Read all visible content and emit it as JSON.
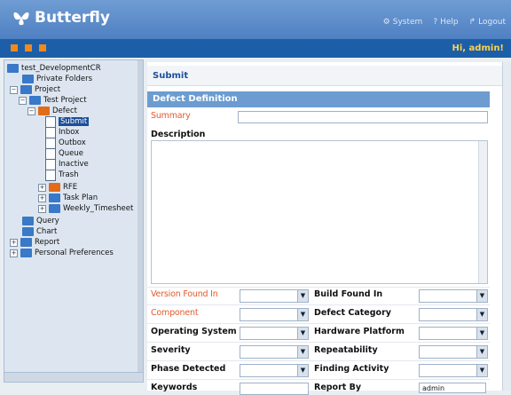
{
  "header": {
    "app_name": "Butterfly",
    "nav": {
      "system": "System",
      "help": "Help",
      "logout": "Logout"
    },
    "greeting": "Hi, admin!"
  },
  "tree": {
    "root": "test_DevelopmentCR",
    "private_folders": "Private Folders",
    "project": "Project",
    "test_project": "Test Project",
    "defect": "Defect",
    "submit": "Submit",
    "inbox": "Inbox",
    "outbox": "Outbox",
    "queue": "Queue",
    "inactive": "Inactive",
    "trash": "Trash",
    "rfe": "RFE",
    "task_plan": "Task Plan",
    "weekly_timesheet": "Weekly_Timesheet",
    "query": "Query",
    "chart": "Chart",
    "report": "Report",
    "personal_preferences": "Personal Preferences"
  },
  "form": {
    "breadcrumb": "Submit",
    "section_title": "Defect Definition",
    "summary_label": "Summary",
    "description_label": "Description",
    "version_found_in": "Version Found In",
    "build_found_in": "Build Found In",
    "component": "Component",
    "defect_category": "Defect Category",
    "operating_system": "Operating System",
    "hardware_platform": "Hardware Platform",
    "severity": "Severity",
    "repeatability": "Repeatability",
    "phase_detected": "Phase Detected",
    "finding_activity": "Finding Activity",
    "keywords": "Keywords",
    "report_by": "Report By",
    "report_by_value": "admin"
  }
}
